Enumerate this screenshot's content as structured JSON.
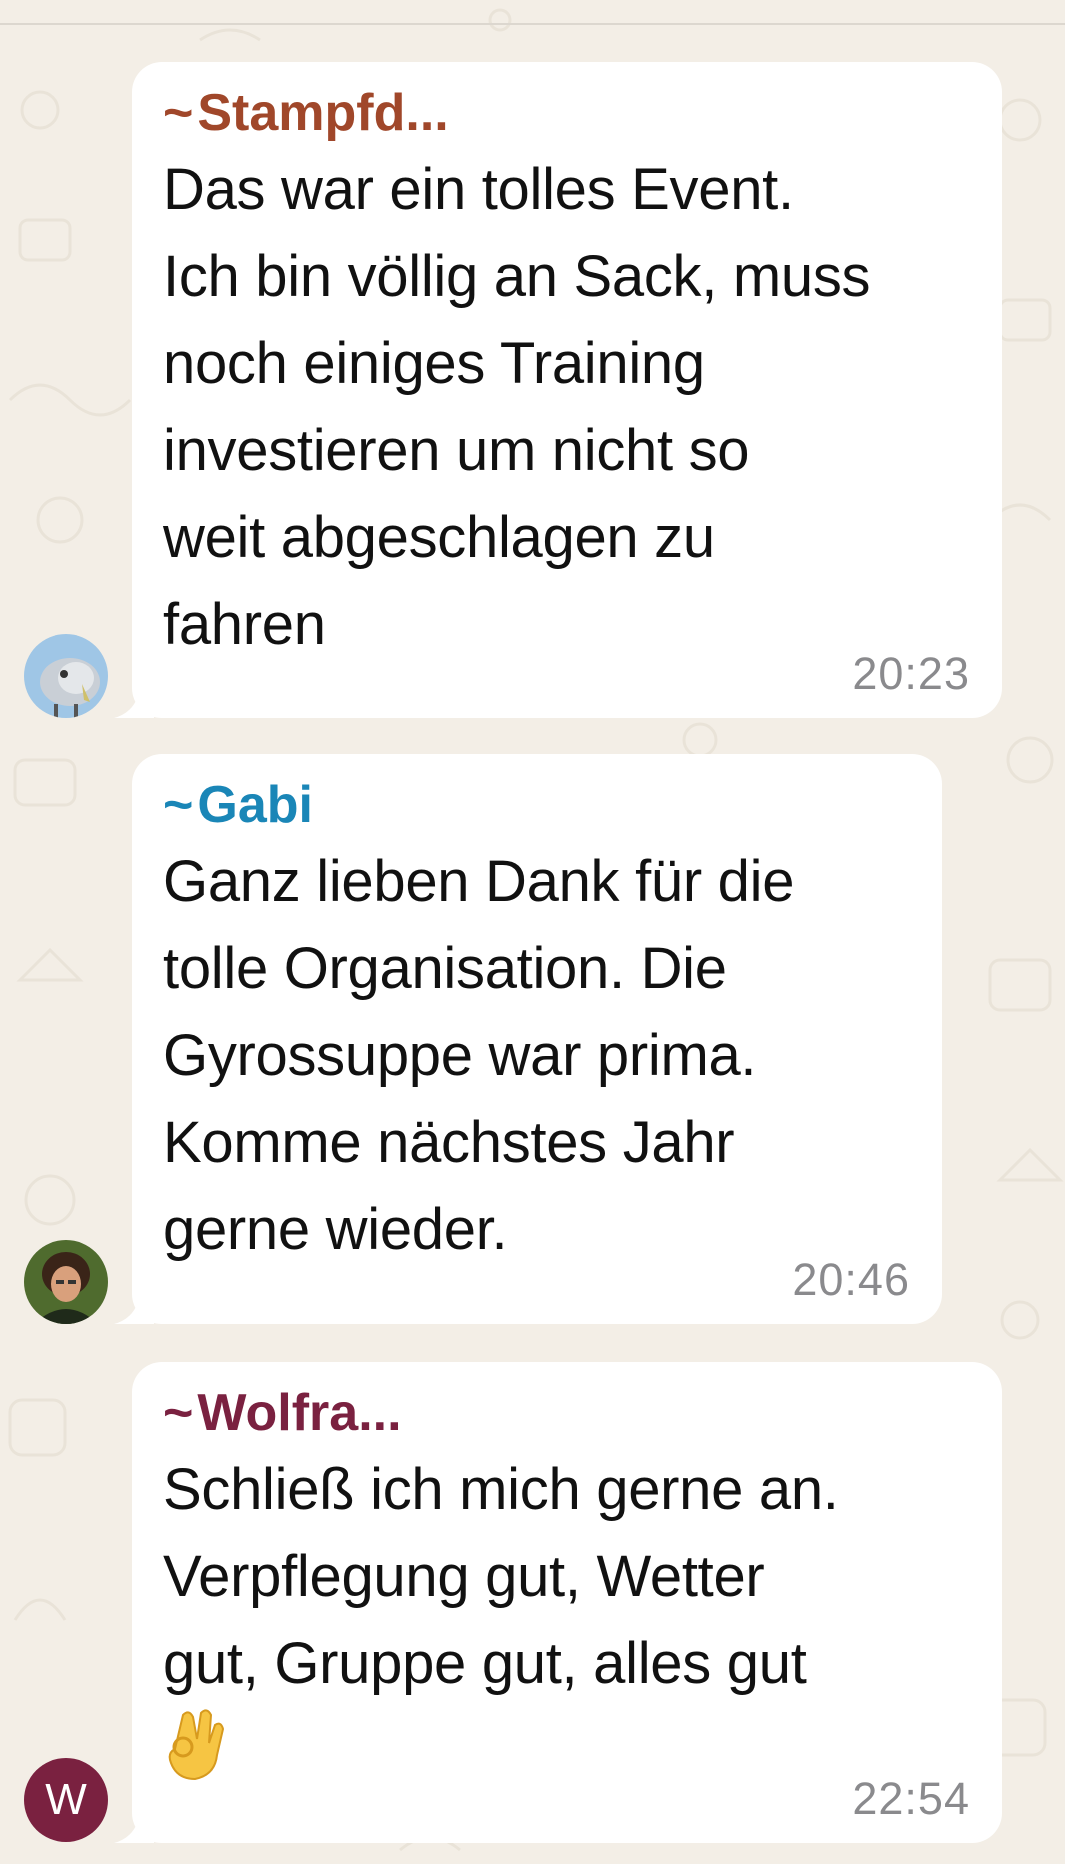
{
  "messages": [
    {
      "sender": "Stampfd...",
      "sender_color": "#a0472a",
      "lines": [
        "Das war ein tolles Event.",
        "Ich bin völlig an Sack, muss",
        "noch einiges Training",
        "investieren um nicht so",
        "weit abgeschlagen zu",
        "fahren"
      ],
      "time": "20:23",
      "avatar": "bird-photo"
    },
    {
      "sender": "Gabi",
      "sender_color": "#1a86b7",
      "lines": [
        "Ganz lieben Dank für die",
        "tolle Organisation. Die",
        "Gyrossuppe war prima.",
        "Komme nächstes Jahr",
        "gerne wieder."
      ],
      "time": "20:46",
      "avatar": "person-photo"
    },
    {
      "sender": "Wolfra...",
      "sender_color": "#7a2140",
      "lines": [
        "Schließ ich mich gerne an.",
        "Verpflegung gut, Wetter",
        "gut, Gruppe gut, alles gut"
      ],
      "emoji": "ok-hand-emoji",
      "time": "22:54",
      "avatar_letter": "W",
      "avatar_color": "#7a2140"
    }
  ],
  "tilde": "~"
}
